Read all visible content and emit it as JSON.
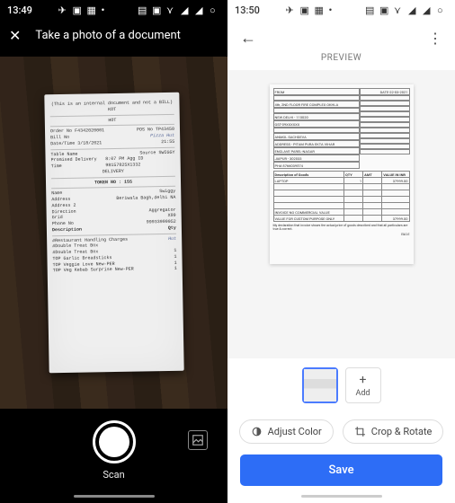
{
  "left": {
    "status": {
      "time": "13:49"
    },
    "title": "Take a photo of a document",
    "scan_label": "Scan",
    "receipt": {
      "header_line1": "(This is an internal document and not a BILL)",
      "header_line2": "KOT",
      "header_line3": "HOT",
      "order_no_label": "Order No",
      "order_no": "F4342020001",
      "pos_label": "POS No",
      "pos_no": "TP43450",
      "bill_no_label": "Bill No",
      "bill_no_hw": "Pizza Hut",
      "date_label": "Date/Time",
      "date": "3/18/2021",
      "time": "21:55",
      "table_label": "Table Name",
      "source_label": "Source",
      "source": "SWIGGY",
      "promised_label": "Promised Delivery Time",
      "prom_time": "8:07 PM",
      "agg_id_label": "Agg ID",
      "agg_id": "98157825X1332",
      "method": "DELIVERY",
      "token_label": "TOKEN NO",
      "token_no": "155",
      "name_label": "Name",
      "name": "Swiggy",
      "address_label": "Address",
      "address": "Beriwala Bagh,delhi NA",
      "address2_label": "Address 2",
      "direction_label": "Direction",
      "direction": "Aggregator",
      "grid_label": "Grid",
      "grid": "X99",
      "phone_label": "Phone No",
      "phone": "99933999952",
      "desc_label": "Description",
      "qty_label": "Qty",
      "items": [
        {
          "name": "#Restaurant Handling Charges",
          "qty": "Hut"
        },
        {
          "name": "#Double Treat Box",
          "qty": ""
        },
        {
          "name": "#Double Treat Box",
          "qty": "1"
        },
        {
          "name": "TOP Garlic Breadsticks",
          "qty": "1"
        },
        {
          "name": "TOP Veggie Love New-PER",
          "qty": "1"
        },
        {
          "name": "TOP Veg Kebab Surprise New-PER",
          "qty": "1"
        }
      ]
    }
  },
  "right": {
    "status": {
      "time": "13:50"
    },
    "preview_label": "PREVIEW",
    "add_label": "Add",
    "adjust_color_label": "Adjust Color",
    "crop_rotate_label": "Crop & Rotate",
    "save_label": "Save",
    "invoice": {
      "date_label": "DATE-22-03-2021",
      "from": "FROM",
      "addr1": "4th, 2ND FLOOR FIRE COMPLEX OKHLA",
      "city": "NEW DELHI - 110020",
      "gst": "GST-09XXXXXX",
      "to_name": "ANMOL SACHDEVA",
      "to_addr": "ADDRESS - PITAM PURA EKTA VIHAR",
      "to_area": "ENCLAVE PAREL-NAGAR",
      "to_city": "JAIPUR - 302033",
      "to_phone": "PH# 8766039574",
      "th_desc": "Description of Goods",
      "th_qty": "QTY",
      "th_amt": "AMT",
      "th_val": "VALUE IN INR",
      "row1_desc": "LAPTOP",
      "row1_qty": "1",
      "row1_val": "37999.00",
      "note1": "INVOICE NO COMMERCIAL VALUE",
      "note2": "VALUE FOR CUSTOM PURPOSE ONLY",
      "total": "37999.00",
      "declare": "My declaration that invoice shows the actual price of goods described and that all particulars are true & correct.",
      "eoe": "E&O.E"
    }
  }
}
